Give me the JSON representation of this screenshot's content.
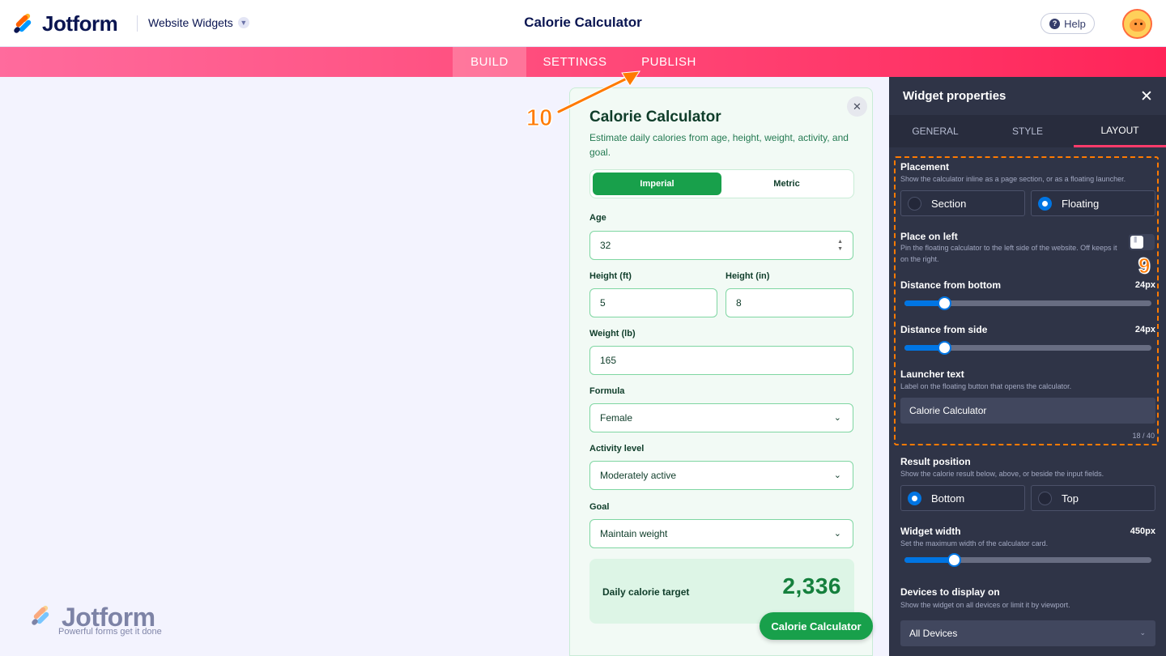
{
  "app": {
    "brand": "Jotform",
    "product": "Website Widgets",
    "page_title": "Calorie Calculator",
    "help_label": "Help"
  },
  "nav": {
    "tabs": [
      "BUILD",
      "SETTINGS",
      "PUBLISH"
    ],
    "active": "BUILD"
  },
  "annotations": {
    "arrow_label": "10",
    "box_label": "9"
  },
  "widget": {
    "title": "Calorie Calculator",
    "subtitle": "Estimate daily calories from age, height, weight, activity, and goal.",
    "units": {
      "imperial": "Imperial",
      "metric": "Metric",
      "selected": "Imperial"
    },
    "fields": {
      "age": {
        "label": "Age",
        "value": "32"
      },
      "height_ft": {
        "label": "Height (ft)",
        "value": "5"
      },
      "height_in": {
        "label": "Height (in)",
        "value": "8"
      },
      "weight": {
        "label": "Weight (lb)",
        "value": "165"
      },
      "formula": {
        "label": "Formula",
        "value": "Female"
      },
      "activity": {
        "label": "Activity level",
        "value": "Moderately active"
      },
      "goal": {
        "label": "Goal",
        "value": "Maintain weight"
      }
    },
    "result": {
      "label": "Daily calorie target",
      "value": "2,336"
    },
    "launcher_button": "Calorie Calculator"
  },
  "watermark": {
    "brand": "Jotform",
    "tagline": "Powerful forms get it done"
  },
  "panel": {
    "title": "Widget properties",
    "tabs": [
      "GENERAL",
      "STYLE",
      "LAYOUT"
    ],
    "active_tab": "LAYOUT",
    "placement": {
      "title": "Placement",
      "desc": "Show the calculator inline as a page section, or as a floating launcher.",
      "options": [
        "Section",
        "Floating"
      ],
      "selected": "Floating"
    },
    "place_left": {
      "title": "Place on left",
      "desc": "Pin the floating calculator to the left side of the website. Off keeps it on the right.",
      "enabled": false
    },
    "distance_bottom": {
      "title": "Distance from bottom",
      "value_label": "24px",
      "fraction": 0.16
    },
    "distance_side": {
      "title": "Distance from side",
      "value_label": "24px",
      "fraction": 0.16
    },
    "launcher_text": {
      "title": "Launcher text",
      "desc": "Label on the floating button that opens the calculator.",
      "value": "Calorie Calculator",
      "counter": "18 / 40"
    },
    "result_position": {
      "title": "Result position",
      "desc": "Show the calorie result below, above, or beside the input fields.",
      "options": [
        "Bottom",
        "Top"
      ],
      "selected": "Bottom"
    },
    "widget_width": {
      "title": "Widget width",
      "desc": "Set the maximum width of the calculator card.",
      "value_label": "450px",
      "fraction": 0.2
    },
    "devices": {
      "title": "Devices to display on",
      "desc": "Show the widget on all devices or limit it by viewport.",
      "value": "All Devices"
    }
  },
  "colors": {
    "accent_pink": "#ff2458",
    "green": "#18a04b",
    "blue": "#0075e3",
    "annotation_orange": "#ff7a00",
    "panel_bg": "#2f3447"
  }
}
